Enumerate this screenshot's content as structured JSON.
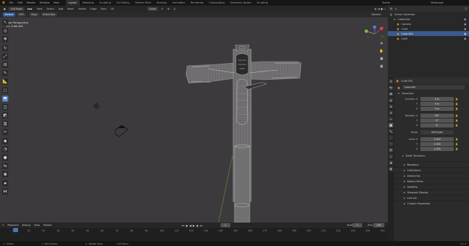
{
  "menubar": {
    "items": [
      "File",
      "Edit",
      "Render",
      "Window",
      "Help"
    ],
    "workspaces": [
      "Layout",
      "Modeling",
      "Sculpting",
      "UV Editing",
      "Texture Paint",
      "Shading",
      "Animation",
      "Rendering",
      "Compositing",
      "Geometry Nodes",
      "Scripting"
    ],
    "active_workspace": "Layout",
    "scene": "Scene",
    "view_layer": "ViewLayer"
  },
  "header": {
    "mode": "Edit Mode",
    "menus": [
      "View",
      "Select",
      "Add",
      "Mesh",
      "Vertex",
      "Edge",
      "Face",
      "UV"
    ],
    "orientation": "Global"
  },
  "subheader": {
    "normal": "Normal",
    "xyz": "XYZ",
    "snap": "Snap",
    "select_box": "Select Box",
    "options": "Options"
  },
  "viewport": {
    "overlay_title": "User Perspective",
    "overlay_object": "(1) Cube.001"
  },
  "outliner": {
    "rows": [
      {
        "label": "Scene Collection",
        "indent": 0,
        "selected": false
      },
      {
        "label": "Collection",
        "indent": 1,
        "selected": false
      },
      {
        "label": "Camera",
        "indent": 2,
        "selected": false
      },
      {
        "label": "Cube",
        "indent": 2,
        "selected": false
      },
      {
        "label": "Cube.001",
        "indent": 2,
        "selected": true
      },
      {
        "label": "Light",
        "indent": 2,
        "selected": false
      }
    ]
  },
  "properties": {
    "object_breadcrumb": "Cube.001",
    "object_name": "Cube.001",
    "transform_label": "Transform",
    "location": {
      "label": "Location X",
      "x": "0 m",
      "y": "0 m",
      "z": "0 m"
    },
    "rotation": {
      "label": "Rotation X",
      "x": "90°",
      "y": "0°",
      "z": "0°"
    },
    "mode": {
      "label": "Mode",
      "value": "XYZ Euler"
    },
    "scale": {
      "label": "Scale X",
      "x": "1.000",
      "y": "1.000",
      "z": "1.000"
    },
    "delta_transform": "Delta Transform",
    "panels": [
      "Relations",
      "Collections",
      "Instancing",
      "Motion Paths",
      "Visibility",
      "Viewport Display",
      "Line Art",
      "Custom Properties"
    ]
  },
  "timeline": {
    "menus": [
      "Playback",
      "Keying",
      "View",
      "Marker"
    ],
    "current_frame": "1",
    "start_label": "Start",
    "start": "1",
    "end_label": "End",
    "end": "250",
    "ticks": [
      "0",
      "10",
      "20",
      "30",
      "40",
      "50",
      "60",
      "70",
      "80",
      "90",
      "100",
      "110",
      "120",
      "130",
      "140",
      "150",
      "160",
      "170",
      "180",
      "190",
      "200",
      "210",
      "220",
      "230",
      "240",
      "250"
    ]
  },
  "statusbar": {
    "left": "Select",
    "middle": "Box Select",
    "right": "Rotate View",
    "extra": "Call Menu",
    "version": "4.1.0"
  },
  "colors": {
    "accent": "#4a76b8",
    "viewport_bg": "#3c3c3c",
    "axis_x": "#d9425b",
    "axis_y": "#7fbf3f",
    "axis_z": "#4f7fe0"
  }
}
